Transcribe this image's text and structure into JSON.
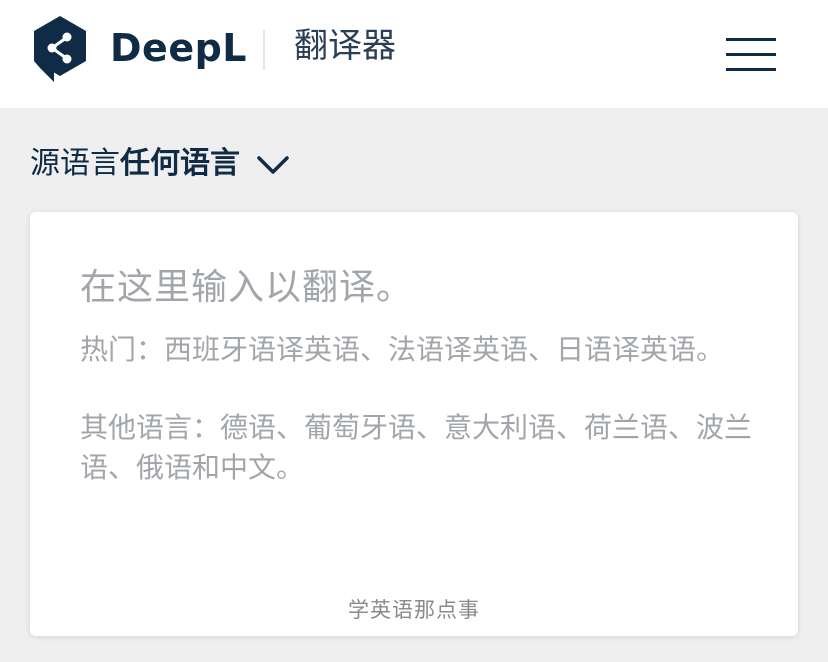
{
  "header": {
    "brand": "DeepL",
    "product_title": "翻译器",
    "logo_icon": "deepl-share-logo",
    "menu_icon": "hamburger-menu-icon"
  },
  "source_language": {
    "prefix": "源语言",
    "value": "任何语言",
    "icon": "chevron-down-icon"
  },
  "input": {
    "placeholder": "在这里输入以翻译。",
    "popular_hint": "热门：西班牙语译英语、法语译英语、日语译英语。",
    "other_hint": "其他语言：德语、葡萄牙语、意大利语、荷兰语、波兰语、俄语和中文。"
  },
  "watermark": "学英语那点事",
  "colors": {
    "brand_navy": "#0f2b46",
    "background": "#efefef",
    "card": "#ffffff",
    "placeholder_text": "#a2a6aa"
  }
}
